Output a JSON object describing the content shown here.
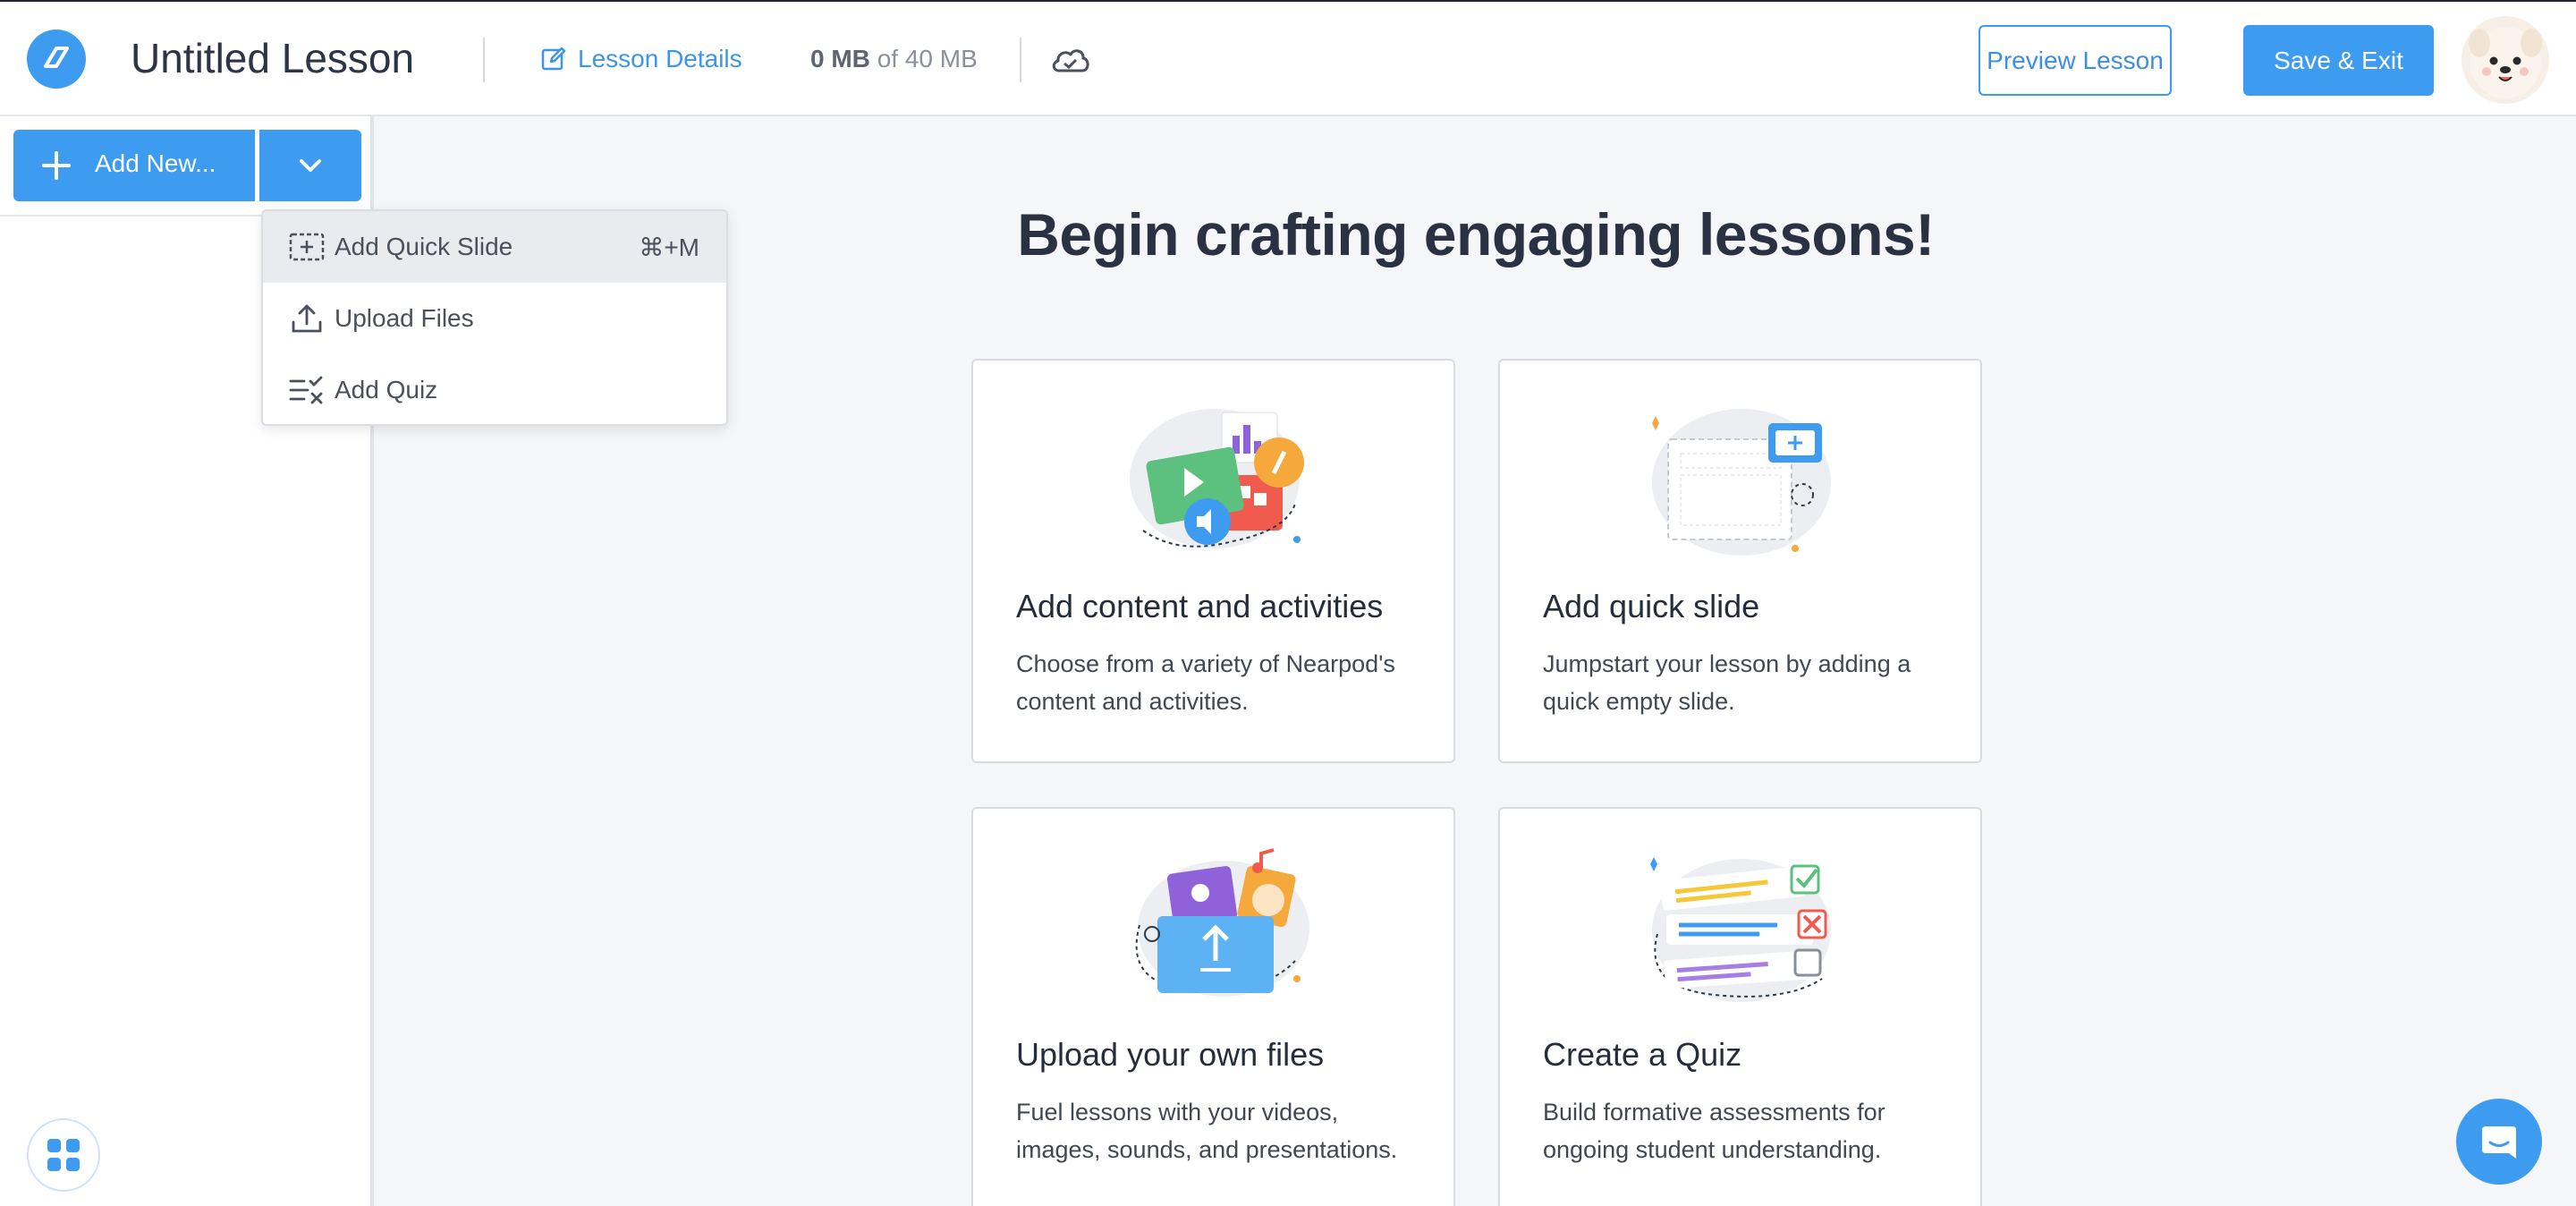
{
  "header": {
    "lesson_title": "Untitled Lesson",
    "lesson_details_label": "Lesson Details",
    "storage_used": "0 MB",
    "storage_total": "of 40 MB",
    "preview_label": "Preview Lesson",
    "save_exit_label": "Save & Exit",
    "icons": [
      "nearpod-logo-icon",
      "edit-icon",
      "cloud-sync-icon",
      "avatar"
    ]
  },
  "sidebar": {
    "add_new_label": "Add New...",
    "icons": [
      "plus-icon",
      "chevron-down-icon",
      "apps-grid-icon"
    ]
  },
  "dropdown": {
    "items": [
      {
        "label": "Add Quick Slide",
        "shortcut": "⌘+M",
        "icon": "quick-slide-icon",
        "highlighted": true
      },
      {
        "label": "Upload Files",
        "icon": "upload-icon"
      },
      {
        "label": "Add Quiz",
        "icon": "quiz-icon"
      }
    ]
  },
  "main": {
    "heading": "Begin crafting engaging lessons!",
    "cards": [
      {
        "title": "Add content and activities",
        "description": "Choose from a variety of Nearpod's content and activities."
      },
      {
        "title": "Add quick slide",
        "description": "Jumpstart your lesson by adding a quick empty slide."
      },
      {
        "title": "Upload your own files",
        "description": "Fuel lessons with your videos, images, sounds, and presentations."
      },
      {
        "title": "Create a Quiz",
        "description": "Build formative assessments for ongoing student understanding."
      }
    ]
  },
  "colors": {
    "accent": "#3d9bf0",
    "text_dark": "#2a3142",
    "background": "#f5f6f7"
  }
}
